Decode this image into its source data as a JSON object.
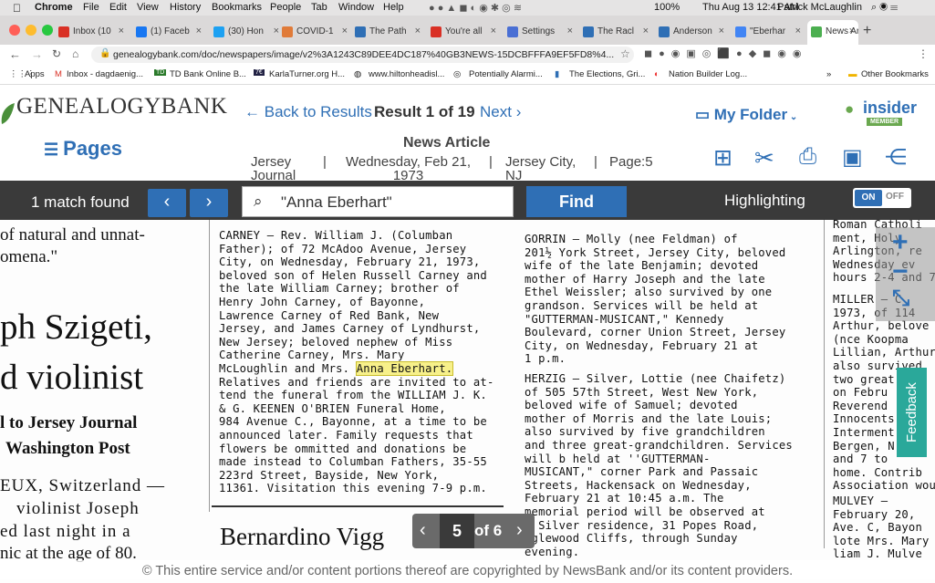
{
  "macbar": {
    "apple": "",
    "app": "Chrome",
    "menus": [
      "File",
      "Edit",
      "View",
      "History",
      "Bookmarks",
      "People",
      "Tab",
      "Window",
      "Help"
    ],
    "battery": "100%",
    "datetime": "Thu Aug 13  12:41 AM",
    "user": "Patrick McLaughlin"
  },
  "tabs": [
    {
      "label": "Inbox (10",
      "color": "#d93025"
    },
    {
      "label": "(1) Faceb",
      "color": "#1877f2"
    },
    {
      "label": "(30) Hon",
      "color": "#1da1f2"
    },
    {
      "label": "COVID-1",
      "color": "#e07b39"
    },
    {
      "label": "The Path",
      "color": "#2f6fb5"
    },
    {
      "label": "You're all",
      "color": "#d93025"
    },
    {
      "label": "Settings",
      "color": "#4a6fd4"
    },
    {
      "label": "The Racl",
      "color": "#2f6fb5"
    },
    {
      "label": "Anderson",
      "color": "#2f6fb5"
    },
    {
      "label": "\"Eberhar",
      "color": "#4285f4"
    },
    {
      "label": "News Ar",
      "color": "#4caf50"
    }
  ],
  "address": {
    "url": "genealogybank.com/doc/newspapers/image/v2%3A1243C89DEE4DC187%40GB3NEWS-15DCBFFFA9EF5FD8%4..."
  },
  "bookmarks": [
    "Apps",
    "Inbox - dagdaenig...",
    "TD Bank Online B...",
    "KarlaTurner.org H...",
    "www.hiltonheadisl...",
    "Potentially Alarmi...",
    "The Elections, Gri...",
    "Nation Builder Log...",
    "»",
    "Other Bookmarks"
  ],
  "header": {
    "logo": "GENEALOGYBANK",
    "pages": "Pages",
    "back": "Back to Results",
    "result": "Result 1 of 19",
    "next": "Next",
    "folder": "My Folder",
    "insider": "insider",
    "member": "MEMBER",
    "article_type": "News Article",
    "paper": "Jersey Journal",
    "date": "Wednesday, Feb 21, 1973",
    "place": "Jersey City, NJ",
    "page": "Page:5"
  },
  "toolbar": {
    "matches": "1 match found",
    "query": "\"Anna Eberhart\"",
    "find": "Find",
    "highlighting": "Highlighting",
    "on": "ON",
    "off": "OFF"
  },
  "paper": {
    "left": [
      "of natural and unnat-",
      "omena.\"",
      "ph Szigeti,",
      "d violinist",
      "l to Jersey Journal",
      "Washington Post",
      "EUX, Switzerland —",
      "violinist Joseph",
      "ed last night in a",
      "nic at the age of 80."
    ],
    "col1_before": "CARNEY — Rev. William J. (Columban\nFather); of 72 McAdoo Avenue, Jersey\nCity, on Wednesday, February 21, 1973,\nbeloved son of Helen Russell Carney and\nthe late William Carney; brother of\nHenry John Carney, of Bayonne,\nLawrence Carney of Red Bank, New\nJersey, and James Carney of Lyndhurst,\nNew Jersey; beloved nephew of Miss\nCatherine Carney, Mrs. Mary\nMcLoughlin and Mrs. ",
    "col1_highlight": "Anna Eberhart.",
    "col1_after": "\nRelatives and friends are invited to at-\ntend the funeral from the WILLIAM J. K.\n& G. KEENEN O'BRIEN Funeral Home,\n984 Avenue C., Bayonne, at a time to be\nannounced later. Family requests that\nflowers be ommitted and donations be\nmade instead to Columban Fathers, 35-55\n223rd Street, Bayside, New York,\n11361. Visitation this evening 7-9 p.m.",
    "col1_bottom": "Bernardino Vigg",
    "col2_gorrin": "GORRIN — Molly (nee Feldman) of\n201½ York Street, Jersey City, beloved\nwife of the late Benjamin; devoted\nmother of Harry Joseph and the late\nEthel Weissler; also survived by one\ngrandson. Services will be held at\n\"GUTTERMAN-MUSICANT,\" Kennedy\nBoulevard, corner Union Street, Jersey\nCity, on Wednesday, February 21 at\n1 p.m.",
    "col2_herzig": "HERZIG — Silver, Lottie (nee Chaifetz)\nof 505 57th Street, West New York,\nbeloved wife of Samuel; devoted\nmother of Morris and the late Louis;\nalso survived by five grandchildren\nand three great-grandchildren. Services\nwill b held at ''GUTTERMAN-\nMUSICANT,\" corner Park and Passaic\nStreets, Hackensack on Wednesday,\nFebruary 21 at 10:45 a.m. The\nmemorial period will be observed at\ne Silver residence, 31 Popes Road,\nnglewood Cliffs, through Sunday\nevening.",
    "col3_top": "Roman Catholi\nment, Holy\nArlington, re\nWednesday ev\nhours 2-4 and 7-",
    "col3_miller": "MILLER — C\n1973, of 114\nArthur, belove\n(nce Koopma\nLillian, Arthur\nalso survived\ntwo great\non Febru\nReverend\nInnocents\nInterment\nBergen, N\nand 7 to\nhome. Contrib\nAssociation wou",
    "col3_mulvey": "MULVEY —\nFebruary 20,\nAve. C, Bayon\nlote Mrs. Mary\nliam J. Mulve"
  },
  "pager": {
    "current": "5",
    "of": "of 6"
  },
  "feedback": "Feedback",
  "copyright": "© This entire service and/or content portions thereof are copyrighted by NewsBank and/or its content providers."
}
